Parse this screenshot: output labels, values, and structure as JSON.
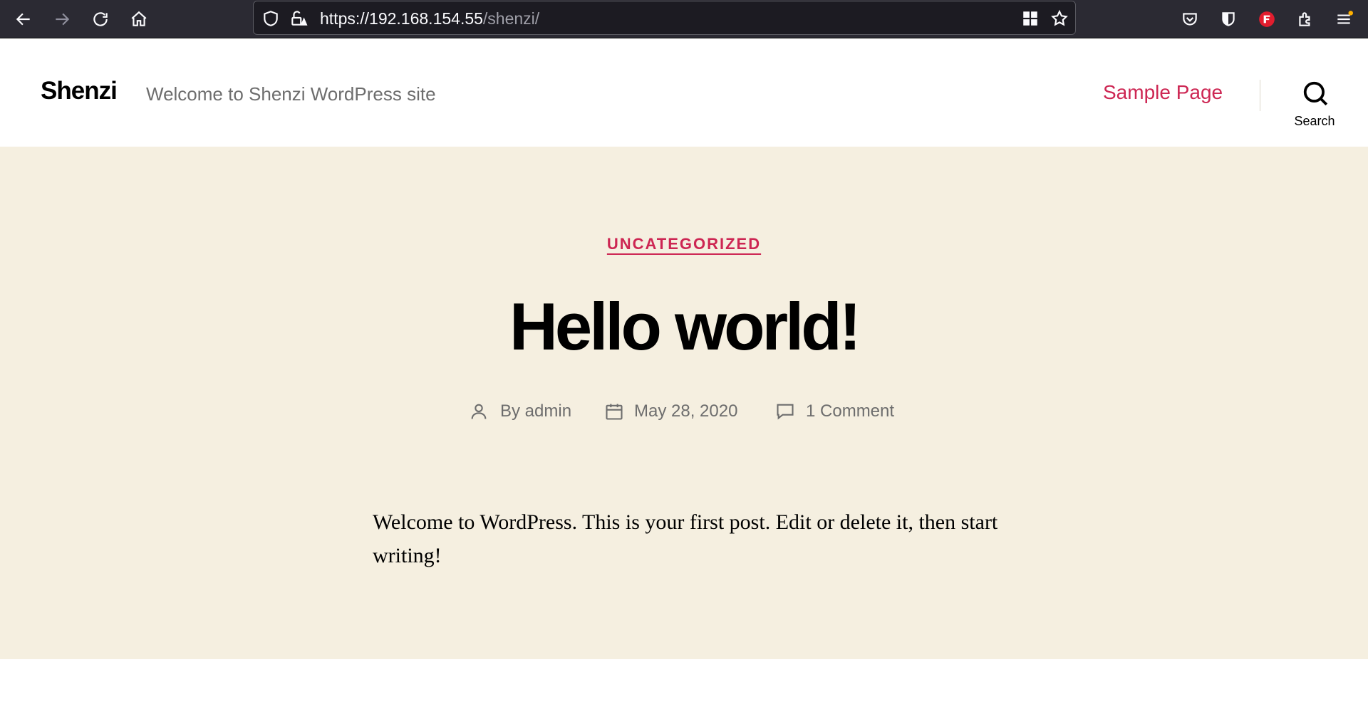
{
  "browser": {
    "url_host": "https://192.168.154.55",
    "url_path": "/shenzi/",
    "icons": [
      "back-icon",
      "forward-icon",
      "reload-icon",
      "home-icon",
      "shield-icon",
      "lock-warning-icon",
      "qr-grid-icon",
      "bookmark-star-icon",
      "pocket-icon",
      "bitwarden-icon",
      "flash-extension-icon",
      "extensions-icon",
      "menu-icon"
    ]
  },
  "site": {
    "title": "Shenzi",
    "description": "Welcome to Shenzi WordPress site",
    "nav": [
      {
        "label": "Sample Page"
      }
    ],
    "search_label": "Search"
  },
  "post": {
    "category": "UNCATEGORIZED",
    "title": "Hello world!",
    "meta": {
      "author": "By admin",
      "date": "May 28, 2020",
      "comments": "1 Comment"
    },
    "body": "Welcome to WordPress. This is your first post. Edit or delete it, then start writing!"
  },
  "colors": {
    "accent": "#cd2653",
    "hero_bg": "#f5efe0",
    "toolbar_bg": "#2b2a33"
  }
}
